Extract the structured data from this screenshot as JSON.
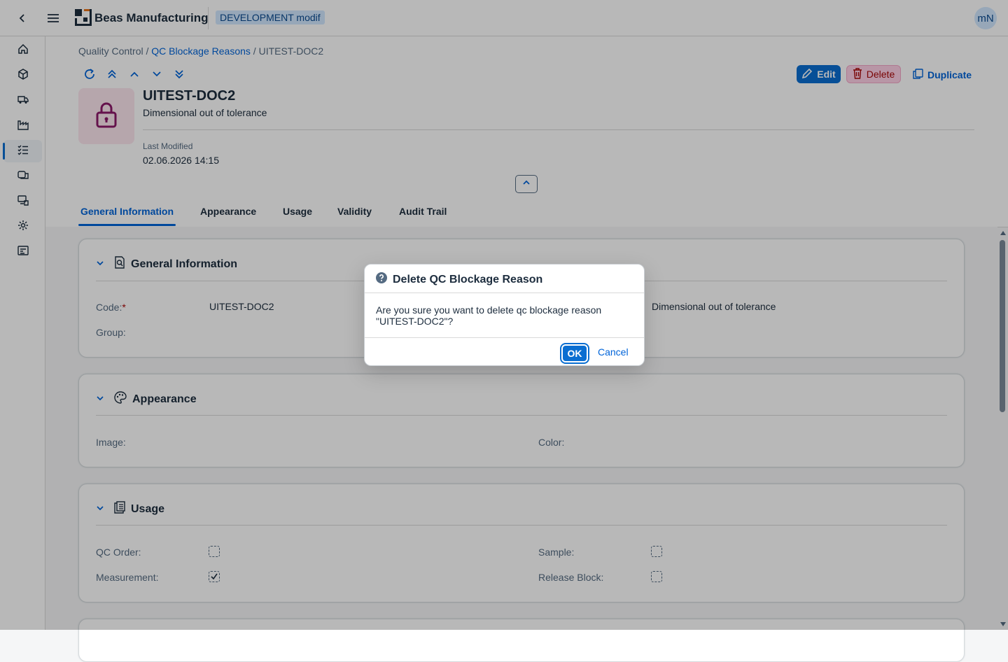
{
  "shell": {
    "app_title": "Beas Manufacturing",
    "environment_badge": "DEVELOPMENT modif",
    "avatar_initials": "mN"
  },
  "breadcrumb": {
    "part1": "Quality Control",
    "sep": " / ",
    "part2": "QC Blockage Reasons",
    "part3": "UITEST-DOC2"
  },
  "actions": {
    "edit": "Edit",
    "delete": "Delete",
    "duplicate": "Duplicate"
  },
  "object": {
    "title": "UITEST-DOC2",
    "subtitle": "Dimensional out of tolerance",
    "last_modified_label": "Last Modified",
    "last_modified_value": "02.06.2026 14:15"
  },
  "tabs": [
    "General Information",
    "Appearance",
    "Usage",
    "Validity",
    "Audit Trail"
  ],
  "sections": {
    "general": {
      "title": "General Information",
      "code_label": "Code:",
      "required_mark": "*",
      "code_value": "UITEST-DOC2",
      "group_label": "Group:",
      "description_value": "Dimensional out of tolerance"
    },
    "appearance": {
      "title": "Appearance",
      "image_label": "Image:",
      "color_label": "Color:"
    },
    "usage": {
      "title": "Usage",
      "qc_order_label": "QC Order:",
      "qc_order_checked": false,
      "measurement_label": "Measurement:",
      "measurement_checked": true,
      "sample_label": "Sample:",
      "sample_checked": false,
      "release_block_label": "Release Block:",
      "release_block_checked": false
    }
  },
  "dialog": {
    "title": "Delete QC Blockage Reason",
    "message_line1": "Are you sure you want to delete qc blockage reason",
    "message_line2": "\"UITEST-DOC2\"?",
    "ok": "OK",
    "cancel": "Cancel"
  },
  "colors": {
    "accent": "#0a6ed1",
    "link": "#0064d9",
    "delete": "#aa0808",
    "object_icon_bg": "#fde6ef",
    "object_icon": "#8c1a6a"
  }
}
